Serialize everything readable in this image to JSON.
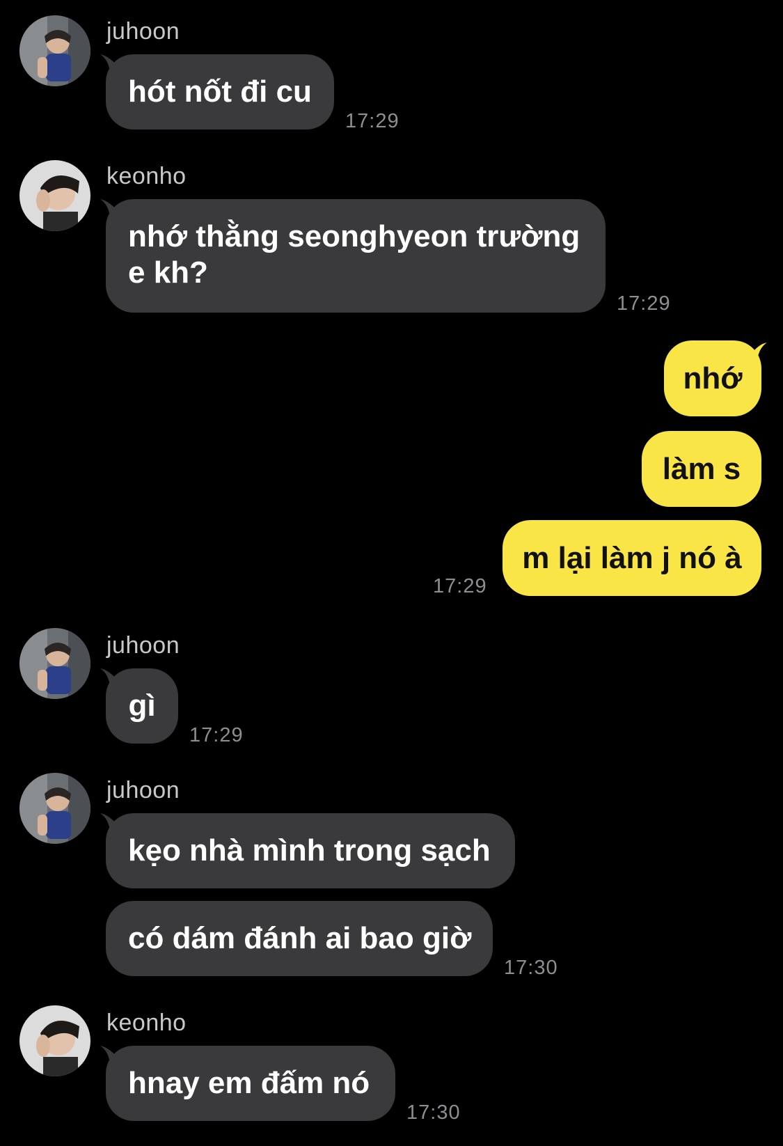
{
  "contacts": {
    "juhoon": "juhoon",
    "keonho": "keonho"
  },
  "messages": {
    "m1": {
      "sender": "juhoon",
      "text": "hót nốt đi cu",
      "time": "17:29"
    },
    "m2": {
      "sender": "keonho",
      "line1": "nhớ thằng seonghyeon trường",
      "line2": "e kh?",
      "time": "17:29"
    },
    "m3": {
      "text": "nhớ"
    },
    "m4": {
      "text": "làm s"
    },
    "m5": {
      "text": "m lại làm j nó à",
      "time": "17:29"
    },
    "m6": {
      "sender": "juhoon",
      "text": "gì",
      "time": "17:29"
    },
    "m7": {
      "sender": "juhoon",
      "text": "kẹo nhà mình trong sạch"
    },
    "m8": {
      "text": "có dám đánh ai bao giờ",
      "time": "17:30"
    },
    "m9": {
      "sender": "keonho",
      "text": "hnay em đấm nó",
      "time": "17:30"
    }
  },
  "colors": {
    "background": "#000000",
    "incoming_bubble": "#3a3a3c",
    "outgoing_bubble": "#f9e545",
    "timestamp": "#8e8e93"
  },
  "icons": {
    "juhoon_avatar": "profile-photo",
    "keonho_avatar": "profile-photo"
  }
}
